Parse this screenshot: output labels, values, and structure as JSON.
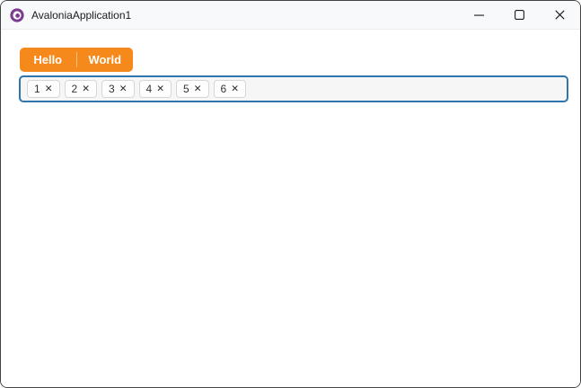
{
  "window": {
    "title": "AvaloniaApplication1"
  },
  "colors": {
    "accent_orange": "#F5891B",
    "tagbox_border_blue": "#2E76AD",
    "logo_purple": "#7B3B8E"
  },
  "split_button": {
    "items": [
      {
        "label": "Hello"
      },
      {
        "label": "World"
      }
    ]
  },
  "tag_box": {
    "remove_glyph": "✕",
    "tags": [
      {
        "label": "1"
      },
      {
        "label": "2"
      },
      {
        "label": "3"
      },
      {
        "label": "4"
      },
      {
        "label": "5"
      },
      {
        "label": "6"
      }
    ]
  }
}
